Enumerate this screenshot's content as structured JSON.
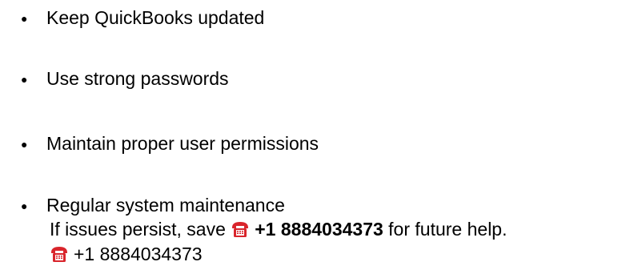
{
  "list": {
    "items": [
      {
        "bullet": "●",
        "label": "Keep QuickBooks updated"
      },
      {
        "bullet": "●",
        "label": "Use strong passwords"
      },
      {
        "bullet": "●",
        "label": "Maintain proper user permissions"
      },
      {
        "bullet": "●",
        "label": "Regular system maintenance"
      }
    ]
  },
  "note": {
    "prefix": "If issues persist, save",
    "phone_bold": "+1 8884034373",
    "suffix": "for future help.",
    "phone_plain": "+1 8884034373",
    "phone_icon": "telephone-icon",
    "icon_color": "#d9252c"
  }
}
